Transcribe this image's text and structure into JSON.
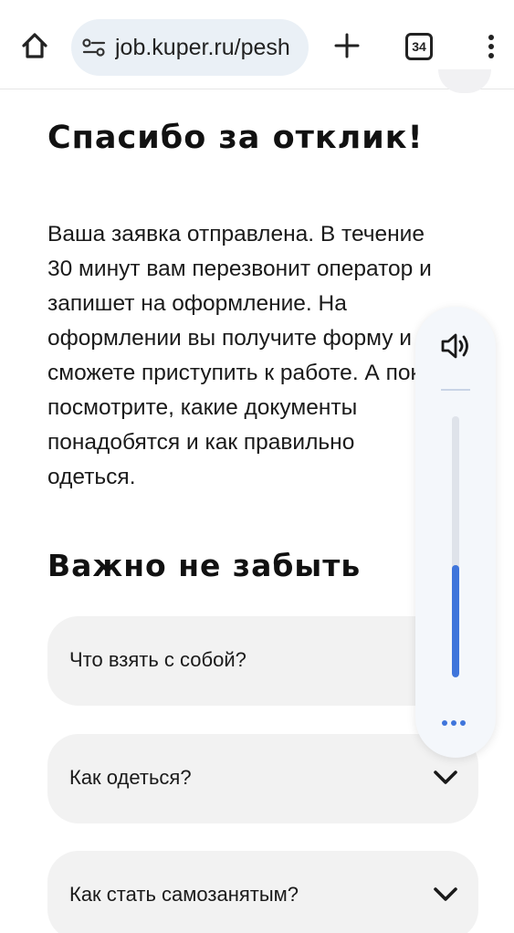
{
  "browser": {
    "url": "job.kuper.ru/pesh",
    "tab_count": "34"
  },
  "page": {
    "title": "Спасибо за отклик!",
    "body": "Ваша заявка отправлена. В течение 30 минут вам перезвонит оператор и запишет на оформление. На оформлении вы получите форму и сможете приступить к работе. А пока посмотрите, какие документы понадобятся и как правильно одеться.",
    "subtitle": "Важно не забыть",
    "faq": [
      {
        "label": "Что взять с собой?"
      },
      {
        "label": "Как одеться?"
      },
      {
        "label": "Как стать самозанятым?"
      }
    ]
  },
  "volume": {
    "level_percent": 43,
    "accent": "#3f75db"
  },
  "icons": [
    "home-icon",
    "site-settings-icon",
    "plus-icon",
    "tab-switcher-icon",
    "more-vert-icon",
    "speaker-icon",
    "chevron-down-icon",
    "more-horiz-icon"
  ]
}
